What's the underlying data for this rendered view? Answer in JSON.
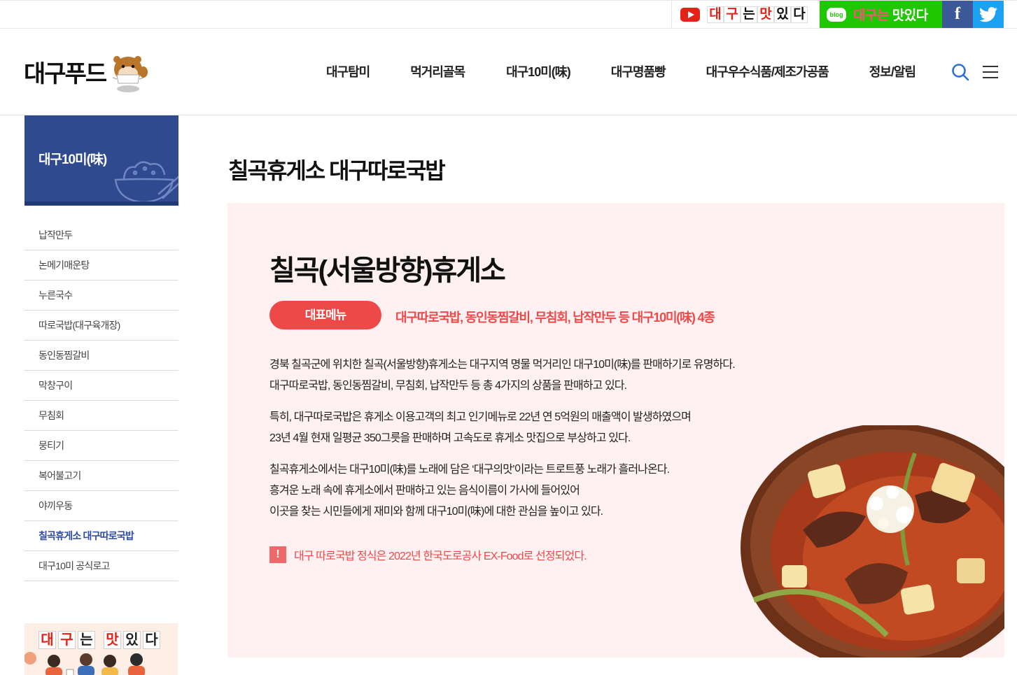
{
  "social": {
    "youtube_chars": [
      "대",
      "구",
      "는",
      "맛",
      "있",
      "다"
    ],
    "youtube_char_colors": [
      "#e62117",
      "#e62117",
      "#111111",
      "#e62117",
      "#111111",
      "#111111"
    ],
    "blog_icon_label": "blog",
    "blog_text_pink": "대구는",
    "blog_text_white": " 맛있다",
    "facebook_glyph": "f"
  },
  "header": {
    "logo_text": "대구푸드",
    "nav": [
      "대구탐미",
      "먹거리골목",
      "대구10미(味)",
      "대구명품빵",
      "대구우수식품/제조가공품",
      "정보/알림"
    ]
  },
  "sidebar": {
    "section_title": "대구10미(味)",
    "items": [
      "납작만두",
      "논메기매운탕",
      "누른국수",
      "따로국밥(대구육개장)",
      "동인동찜갈비",
      "막창구이",
      "무침회",
      "뭉티기",
      "복어불고기",
      "야끼우동",
      "칠곡휴게소 대구따로국밥",
      "대구10미 공식로고"
    ],
    "active_index": 10,
    "banner_chars": [
      "대",
      "구",
      "는",
      "맛",
      "있",
      "다"
    ]
  },
  "content": {
    "page_title": "칠곡휴게소 대구따로국밥",
    "heading": "칠곡(서울방향)휴게소",
    "badge_label": "대표메뉴",
    "badge_text": "대구따로국밥, 동인동찜갈비, 무침회, 납작만두 등 대구10미(味) 4종",
    "paragraphs": [
      [
        "경북 칠곡군에 위치한 칠곡(서울방향)휴게소는 대구지역 명물 먹거리인 대구10미(味)를 판매하기로 유명하다.",
        "대구따로국밥, 동인동찜갈비, 무침회, 납작만두 등 총 4가지의 상품을 판매하고 있다."
      ],
      [
        "특히, 대구따로국밥은 휴게소 이용고객의 최고 인기메뉴로 22년 연 5억원의 매출액이 발생하였으며",
        "23년 4월 현재 일평균 350그릇을 판매하며 고속도로 휴게소 맛집으로 부상하고 있다."
      ],
      [
        "칠곡휴게소에서는 대구10미(味)를 노래에 담은 ‘대구의맛’이라는 트로트풍 노래가 흘러나온다.",
        "흥겨운 노래 속에 휴게소에서 판매하고 있는 음식이름이 가사에 들어있어",
        "이곳을 찾는 시민들에게 재미와 함께 대구10미(味)에 대한 관심을 높이고 있다."
      ]
    ],
    "note_icon": "!",
    "note_text": "대구 따로국밥 정식은 2022년 한국도로공사 EX-Food로 선정되었다."
  },
  "colors": {
    "accent_red": "#ee4949",
    "sidebar_blue": "#2f4a8f",
    "panel_bg": "#fff1f1",
    "active_link": "#2d4aa0"
  }
}
